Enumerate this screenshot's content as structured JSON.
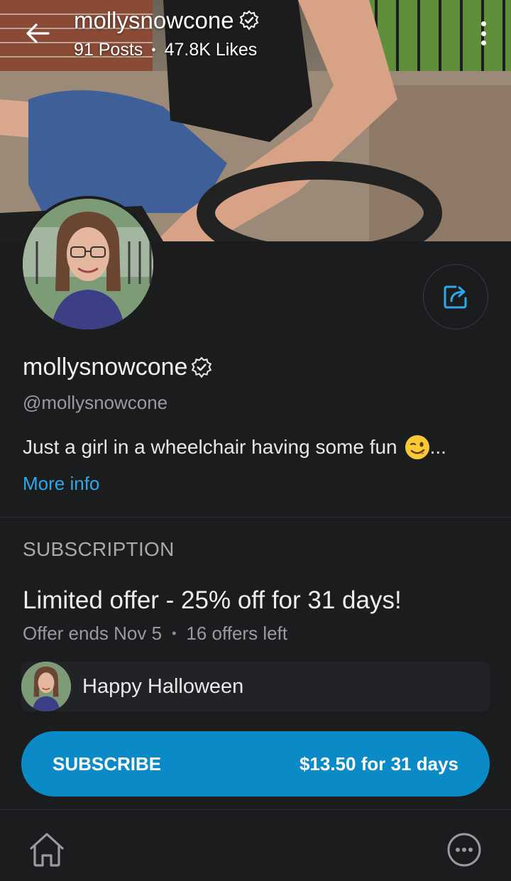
{
  "header": {
    "username": "mollysnowcone",
    "posts": "91 Posts",
    "likes": "47.8K Likes",
    "separator": "•"
  },
  "profile": {
    "display_name": "mollysnowcone",
    "handle": "@mollysnowcone",
    "bio": "Just a girl in a wheelchair having some fun",
    "bio_ellipsis": "...",
    "more_info": "More info"
  },
  "subscription": {
    "section_label": "SUBSCRIPTION",
    "offer_title": "Limited offer - 25% off for 31 days!",
    "offer_ends": "Offer ends Nov 5",
    "separator": "•",
    "offers_left": "16 offers left",
    "promo_message": "Happy Halloween",
    "button_label": "SUBSCRIBE",
    "button_price": "$13.50 for 31 days"
  },
  "colors": {
    "background": "#1b1c1e",
    "accent": "#2fa8ea",
    "button": "#0a8ac7"
  },
  "icons": {
    "back": "arrow-left-icon",
    "menu": "kebab-menu-icon",
    "verified": "verified-badge-icon",
    "share": "share-icon",
    "home": "home-icon",
    "more": "more-circle-icon"
  }
}
